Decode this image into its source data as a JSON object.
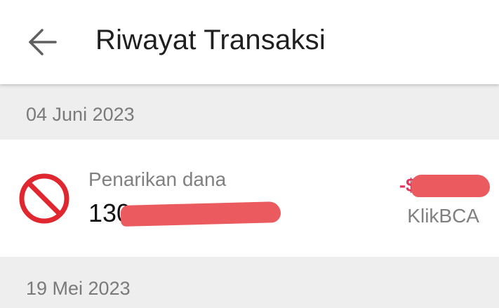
{
  "header": {
    "title": "Riwayat Transaksi",
    "back_icon": "arrow-left-icon"
  },
  "groups": [
    {
      "date": "04 Juni 2023",
      "transactions": [
        {
          "icon": "prohibited-icon",
          "type": "Penarikan dana",
          "account_visible": "130",
          "amount_visible": "-$",
          "method": "KlikBCA"
        }
      ]
    },
    {
      "date": "19 Mei 2023"
    }
  ],
  "colors": {
    "accent_red": "#e2355e",
    "icon_red": "#e0262e",
    "redaction": "#ea5a5e"
  }
}
